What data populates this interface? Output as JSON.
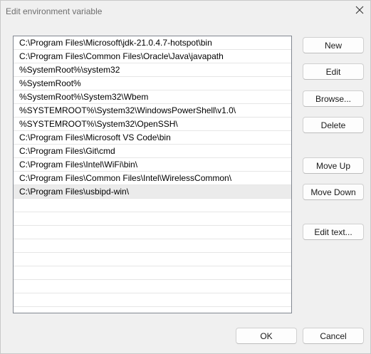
{
  "window": {
    "title": "Edit environment variable"
  },
  "list": {
    "items": [
      "C:\\Program Files\\Microsoft\\jdk-21.0.4.7-hotspot\\bin",
      "C:\\Program Files\\Common Files\\Oracle\\Java\\javapath",
      "%SystemRoot%\\system32",
      "%SystemRoot%",
      "%SystemRoot%\\System32\\Wbem",
      "%SYSTEMROOT%\\System32\\WindowsPowerShell\\v1.0\\",
      "%SYSTEMROOT%\\System32\\OpenSSH\\",
      "C:\\Program Files\\Microsoft VS Code\\bin",
      "C:\\Program Files\\Git\\cmd",
      "C:\\Program Files\\Intel\\WiFi\\bin\\",
      "C:\\Program Files\\Common Files\\Intel\\WirelessCommon\\",
      "C:\\Program Files\\usbipd-win\\"
    ],
    "selected_index": 11,
    "empty_rows": 9
  },
  "buttons": {
    "new": "New",
    "edit": "Edit",
    "browse": "Browse...",
    "delete": "Delete",
    "move_up": "Move Up",
    "move_down": "Move Down",
    "edit_text": "Edit text...",
    "ok": "OK",
    "cancel": "Cancel"
  },
  "colors": {
    "selected_row": "#ebebeb",
    "background": "#f0f0f0"
  },
  "icons": {
    "close": "close-icon"
  }
}
